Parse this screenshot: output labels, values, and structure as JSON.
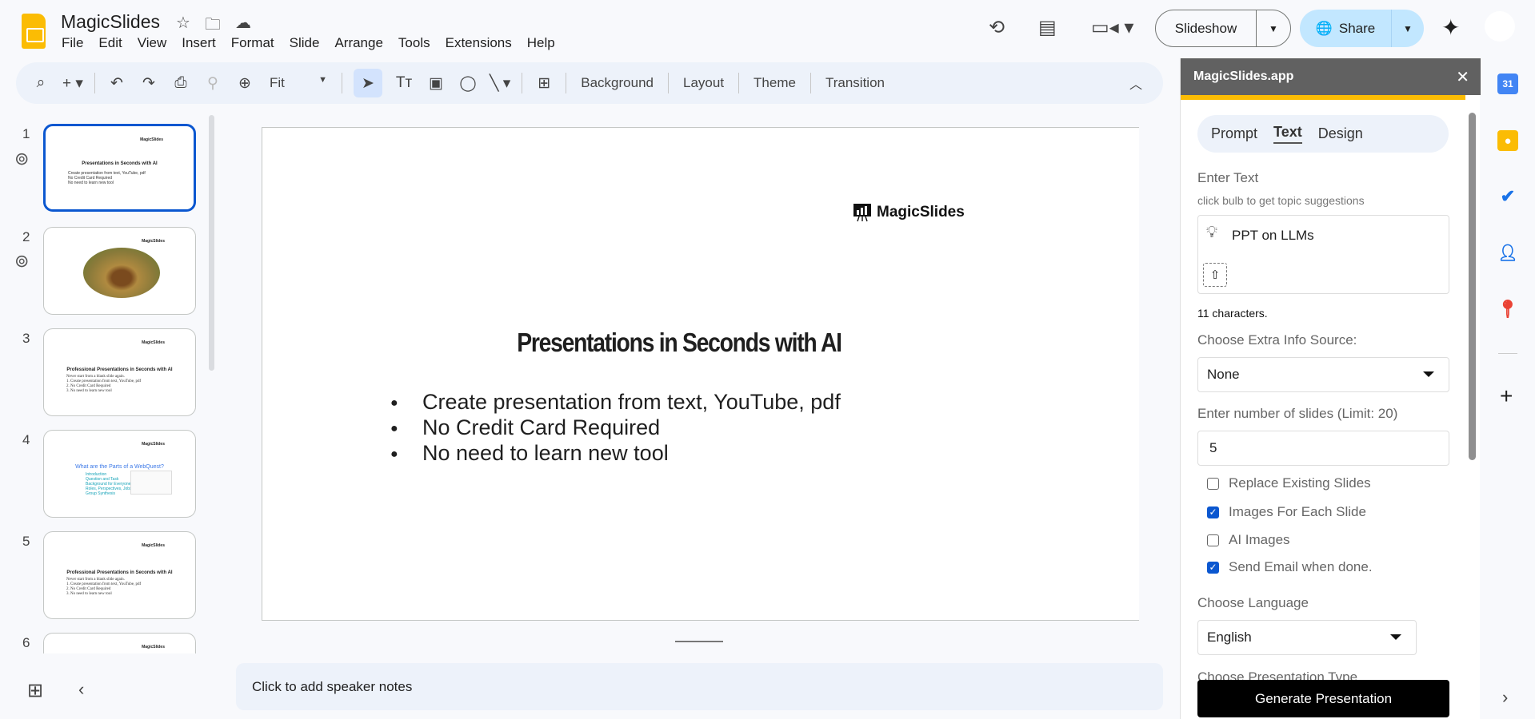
{
  "app": {
    "title": "MagicSlides",
    "menu": [
      "File",
      "Edit",
      "View",
      "Insert",
      "Format",
      "Slide",
      "Arrange",
      "Tools",
      "Extensions",
      "Help"
    ]
  },
  "toolbar": {
    "zoom": "Fit",
    "buttons": [
      "Background",
      "Layout",
      "Theme",
      "Transition"
    ]
  },
  "header": {
    "slideshow": "Slideshow",
    "share": "Share"
  },
  "filmstrip": {
    "slides": [
      {
        "n": "1",
        "logo": "MagicSlides",
        "title": "Presentations in Seconds with AI",
        "bullets": [
          "Create presentation from text, YouTube, pdf",
          "No Credit Card Required",
          "No need to learn new tool"
        ]
      },
      {
        "n": "2",
        "logo": "MagicSlides"
      },
      {
        "n": "3",
        "logo": "MagicSlides",
        "title": "Professional Presentations in Seconds with AI",
        "sub": "Never start from a blank slide again.",
        "bullets": [
          "1. Create presentation from text, YouTube, pdf",
          "2. No Credit Card Required",
          "3. No need to learn new tool"
        ]
      },
      {
        "n": "4",
        "logo": "MagicSlides",
        "title": "What are the Parts of a WebQuest?",
        "bullets": [
          "Introduction",
          "Question and Task",
          "Background for Everyone",
          "Roles, Perspectives, Jobs",
          "Group Synthesis"
        ]
      },
      {
        "n": "5",
        "logo": "MagicSlides",
        "title": "Professional Presentations in Seconds with AI",
        "sub": "Never start from a blank slide again.",
        "bullets": [
          "1. Create presentation from text, YouTube, pdf",
          "2. No Credit Card Required",
          "3. No need to learn new tool"
        ]
      },
      {
        "n": "6",
        "logo": "MagicSlides"
      }
    ]
  },
  "slide": {
    "logo": "MagicSlides",
    "title": "Presentations in Seconds with AI",
    "bullets": [
      "Create presentation from text, YouTube, pdf",
      "No Credit Card Required",
      "No need to learn new tool"
    ]
  },
  "notes": {
    "placeholder": "Click to add speaker notes"
  },
  "panel": {
    "title": "MagicSlides.app",
    "tabs": [
      "Prompt",
      "Text",
      "Design"
    ],
    "active_tab": "Text",
    "enter_text_label": "Enter Text",
    "hint": "click bulb to get topic suggestions",
    "text_value": "PPT on LLMs",
    "char_count": "11 characters.",
    "extra_label": "Choose Extra Info Source:",
    "extra_value": "None",
    "slides_label": "Enter number of slides (Limit: 20)",
    "slides_value": "5",
    "checkboxes": [
      {
        "label": "Replace Existing Slides",
        "checked": false
      },
      {
        "label": "Images For Each Slide",
        "checked": true
      },
      {
        "label": "AI Images",
        "checked": false
      },
      {
        "label": "Send Email when done.",
        "checked": true
      }
    ],
    "language_label": "Choose Language",
    "language_value": "English",
    "type_label": "Choose Presentation Type",
    "generate": "Generate Presentation"
  },
  "colors": {
    "accent": "#0b57d0",
    "panel_header": "#616161",
    "panel_bar": "#fbbc04",
    "share_bg": "#c2e7ff"
  }
}
